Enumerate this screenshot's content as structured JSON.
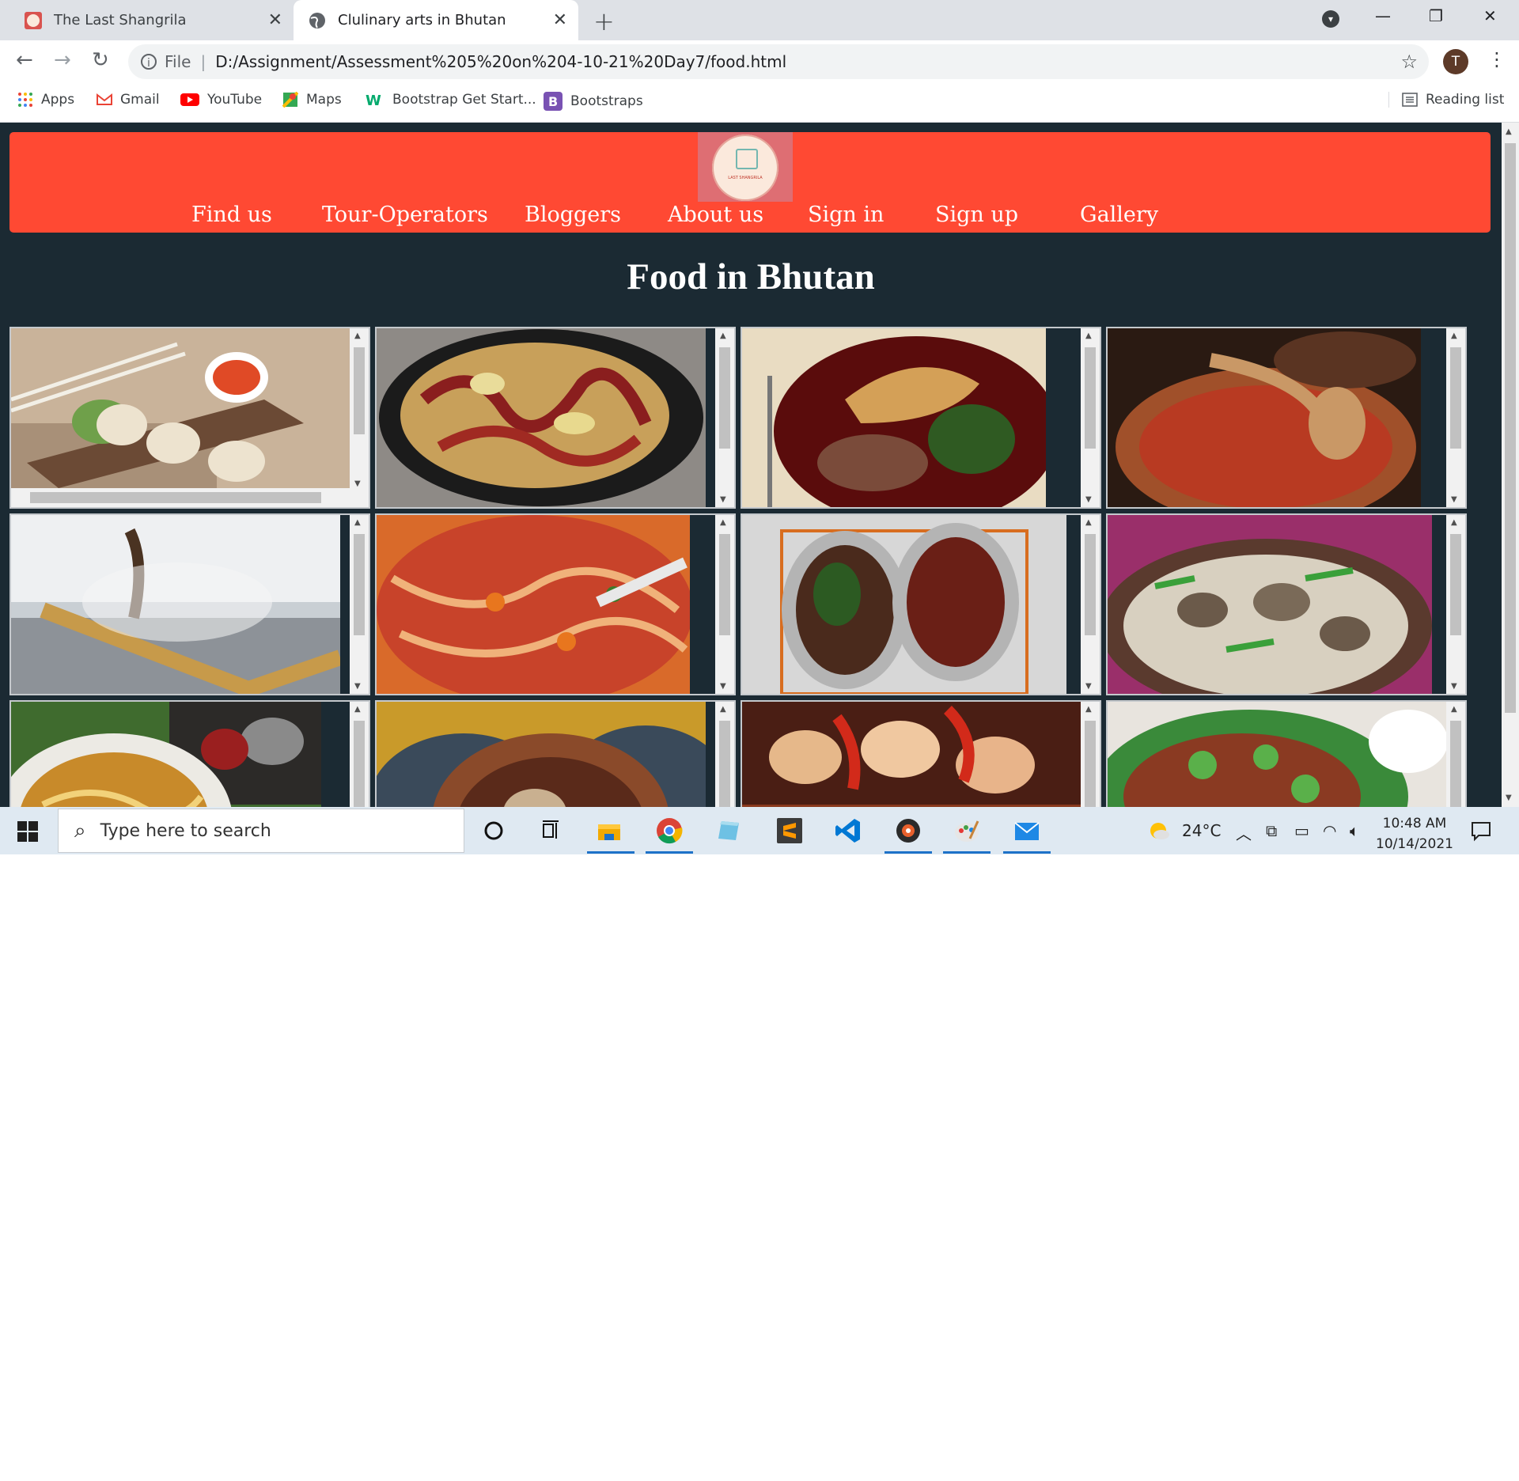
{
  "browser": {
    "tabs": [
      {
        "title": "The Last Shangrila",
        "active": false
      },
      {
        "title": "Clulinary arts in Bhutan",
        "active": true
      }
    ],
    "address": {
      "scheme_label": "File",
      "url": "D:/Assignment/Assessment%205%20on%204-10-21%20Day7/food.html"
    },
    "profile_initial": "T",
    "bookmarks": [
      "Apps",
      "Gmail",
      "YouTube",
      "Maps",
      "Bootstrap Get Start...",
      "Bootstraps"
    ],
    "reading_list": "Reading list"
  },
  "page": {
    "nav": [
      "Find us",
      "Tour-Operators",
      "Bloggers",
      "About us",
      "Sign in",
      "Sign up",
      "Gallery"
    ],
    "heading": "Food in Bhutan",
    "logo_text": "LAST SHANGRILA",
    "dishes": [
      "momos-dish",
      "ema-datshi-dish",
      "fish-with-red-rice-dish",
      "chili-stew-dish",
      "street-grill-dish",
      "noodle-soup-dish",
      "two-bowls-dish",
      "mushroom-datshi-dish",
      "thukpa-dish",
      "pork-stew-dish",
      "phaksha-paa-dish",
      "beef-salad-dish"
    ],
    "colors": {
      "header": "#ff4933",
      "background": "#1b2a33",
      "heading": "#ffffff"
    }
  },
  "taskbar": {
    "search_placeholder": "Type here to search",
    "weather": "24°C",
    "time": "10:48 AM",
    "date": "10/14/2021"
  }
}
